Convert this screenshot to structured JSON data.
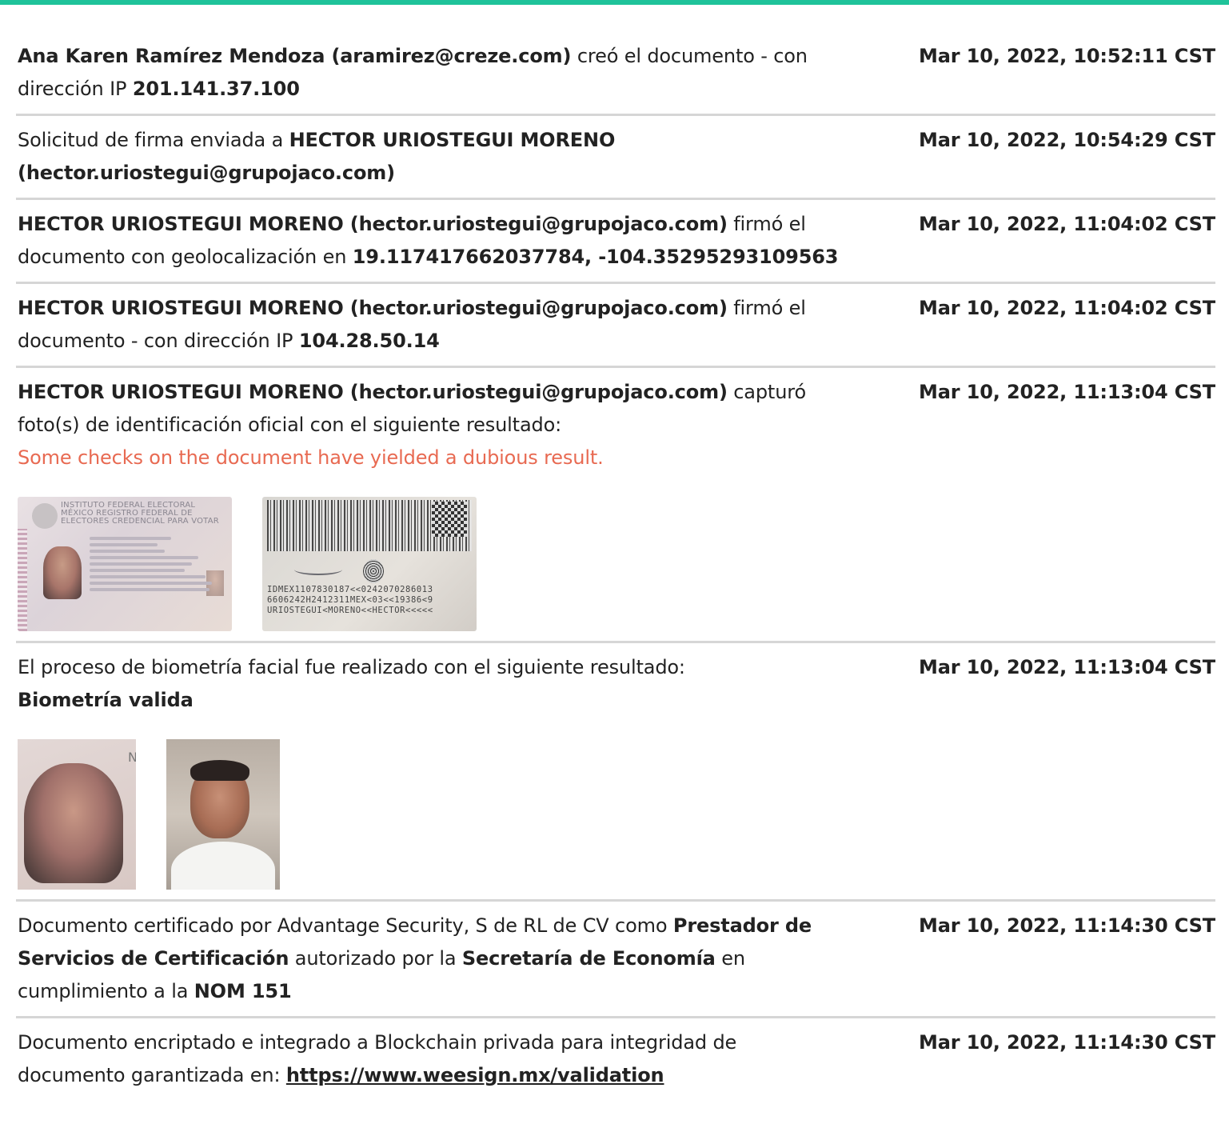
{
  "rows": [
    {
      "parts": [
        {
          "t": "Ana Karen Ramírez Mendoza (aramirez@creze.com)",
          "b": true
        },
        {
          "t": " creó el documento - con dirección IP "
        },
        {
          "t": "201.141.37.100",
          "b": true
        }
      ],
      "timestamp": "Mar 10, 2022, 10:52:11 CST"
    },
    {
      "parts": [
        {
          "t": "Solicitud de firma enviada a "
        },
        {
          "t": "HECTOR URIOSTEGUI MORENO (hector.uriostegui@grupojaco.com)",
          "b": true
        }
      ],
      "timestamp": "Mar 10, 2022, 10:54:29 CST"
    },
    {
      "parts": [
        {
          "t": "HECTOR URIOSTEGUI MORENO (hector.uriostegui@grupojaco.com)",
          "b": true
        },
        {
          "t": " firmó el documento con geolocalización en "
        },
        {
          "t": "19.117417662037784, -104.35295293109563",
          "b": true
        }
      ],
      "timestamp": "Mar 10, 2022, 11:04:02 CST"
    },
    {
      "parts": [
        {
          "t": "HECTOR URIOSTEGUI MORENO (hector.uriostegui@grupojaco.com)",
          "b": true
        },
        {
          "t": " firmó el documento - con dirección IP "
        },
        {
          "t": "104.28.50.14",
          "b": true
        }
      ],
      "timestamp": "Mar 10, 2022, 11:04:02 CST"
    },
    {
      "parts": [
        {
          "t": "HECTOR URIOSTEGUI MORENO (hector.uriostegui@grupojaco.com)",
          "b": true
        },
        {
          "t": " capturó foto(s) de identificación oficial con el siguiente resultado:"
        }
      ],
      "warning": "Some checks on the document have yielded a dubious result.",
      "images": "id",
      "timestamp": "Mar 10, 2022, 11:13:04 CST"
    },
    {
      "parts": [
        {
          "t": "El proceso de biometría facial fue realizado con el siguiente resultado: "
        },
        {
          "t": "Biometría valida",
          "b": true,
          "block": true
        }
      ],
      "images": "bio",
      "timestamp": "Mar 10, 2022, 11:13:04 CST"
    },
    {
      "parts": [
        {
          "t": "Documento certificado por Advantage Security, S de RL de CV como "
        },
        {
          "t": "Prestador de Servicios de Certificación",
          "b": true
        },
        {
          "t": " autorizado por la "
        },
        {
          "t": "Secretaría de Economía",
          "b": true
        },
        {
          "t": " en cumplimiento a la "
        },
        {
          "t": "NOM 151",
          "b": true
        }
      ],
      "timestamp": "Mar 10, 2022, 11:14:30 CST"
    },
    {
      "parts": [
        {
          "t": "Documento encriptado e integrado a Blockchain privada para integridad de documento garantizada en: "
        },
        {
          "t": "https://www.weesign.mx/validation",
          "link": true
        }
      ],
      "timestamp": "Mar 10, 2022, 11:14:30 CST"
    }
  ],
  "id_front": {
    "header": "INSTITUTO FEDERAL ELECTORAL MÉXICO REGISTRO FEDERAL DE ELECTORES CREDENCIAL PARA VOTAR"
  },
  "id_back": {
    "mrz": "IDMEX1107830187<<0242070286013\n6606242H2412311MEX<03<<19386<9\nURIOSTEGUI<MORENO<<HECTOR<<<<<"
  },
  "bio_letters": "NUMHDACMC",
  "colors": {
    "accent": "#1fc39a",
    "warning": "#e86a52",
    "divider": "#d6d6d6"
  }
}
